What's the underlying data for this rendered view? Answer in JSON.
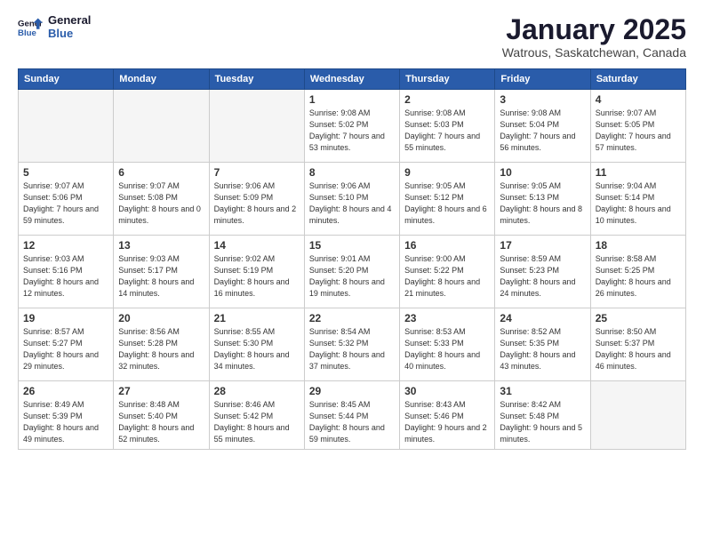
{
  "header": {
    "logo_line1": "General",
    "logo_line2": "Blue",
    "month": "January 2025",
    "location": "Watrous, Saskatchewan, Canada"
  },
  "weekdays": [
    "Sunday",
    "Monday",
    "Tuesday",
    "Wednesday",
    "Thursday",
    "Friday",
    "Saturday"
  ],
  "weeks": [
    [
      {
        "day": "",
        "text": ""
      },
      {
        "day": "",
        "text": ""
      },
      {
        "day": "",
        "text": ""
      },
      {
        "day": "1",
        "text": "Sunrise: 9:08 AM\nSunset: 5:02 PM\nDaylight: 7 hours and 53 minutes."
      },
      {
        "day": "2",
        "text": "Sunrise: 9:08 AM\nSunset: 5:03 PM\nDaylight: 7 hours and 55 minutes."
      },
      {
        "day": "3",
        "text": "Sunrise: 9:08 AM\nSunset: 5:04 PM\nDaylight: 7 hours and 56 minutes."
      },
      {
        "day": "4",
        "text": "Sunrise: 9:07 AM\nSunset: 5:05 PM\nDaylight: 7 hours and 57 minutes."
      }
    ],
    [
      {
        "day": "5",
        "text": "Sunrise: 9:07 AM\nSunset: 5:06 PM\nDaylight: 7 hours and 59 minutes."
      },
      {
        "day": "6",
        "text": "Sunrise: 9:07 AM\nSunset: 5:08 PM\nDaylight: 8 hours and 0 minutes."
      },
      {
        "day": "7",
        "text": "Sunrise: 9:06 AM\nSunset: 5:09 PM\nDaylight: 8 hours and 2 minutes."
      },
      {
        "day": "8",
        "text": "Sunrise: 9:06 AM\nSunset: 5:10 PM\nDaylight: 8 hours and 4 minutes."
      },
      {
        "day": "9",
        "text": "Sunrise: 9:05 AM\nSunset: 5:12 PM\nDaylight: 8 hours and 6 minutes."
      },
      {
        "day": "10",
        "text": "Sunrise: 9:05 AM\nSunset: 5:13 PM\nDaylight: 8 hours and 8 minutes."
      },
      {
        "day": "11",
        "text": "Sunrise: 9:04 AM\nSunset: 5:14 PM\nDaylight: 8 hours and 10 minutes."
      }
    ],
    [
      {
        "day": "12",
        "text": "Sunrise: 9:03 AM\nSunset: 5:16 PM\nDaylight: 8 hours and 12 minutes."
      },
      {
        "day": "13",
        "text": "Sunrise: 9:03 AM\nSunset: 5:17 PM\nDaylight: 8 hours and 14 minutes."
      },
      {
        "day": "14",
        "text": "Sunrise: 9:02 AM\nSunset: 5:19 PM\nDaylight: 8 hours and 16 minutes."
      },
      {
        "day": "15",
        "text": "Sunrise: 9:01 AM\nSunset: 5:20 PM\nDaylight: 8 hours and 19 minutes."
      },
      {
        "day": "16",
        "text": "Sunrise: 9:00 AM\nSunset: 5:22 PM\nDaylight: 8 hours and 21 minutes."
      },
      {
        "day": "17",
        "text": "Sunrise: 8:59 AM\nSunset: 5:23 PM\nDaylight: 8 hours and 24 minutes."
      },
      {
        "day": "18",
        "text": "Sunrise: 8:58 AM\nSunset: 5:25 PM\nDaylight: 8 hours and 26 minutes."
      }
    ],
    [
      {
        "day": "19",
        "text": "Sunrise: 8:57 AM\nSunset: 5:27 PM\nDaylight: 8 hours and 29 minutes."
      },
      {
        "day": "20",
        "text": "Sunrise: 8:56 AM\nSunset: 5:28 PM\nDaylight: 8 hours and 32 minutes."
      },
      {
        "day": "21",
        "text": "Sunrise: 8:55 AM\nSunset: 5:30 PM\nDaylight: 8 hours and 34 minutes."
      },
      {
        "day": "22",
        "text": "Sunrise: 8:54 AM\nSunset: 5:32 PM\nDaylight: 8 hours and 37 minutes."
      },
      {
        "day": "23",
        "text": "Sunrise: 8:53 AM\nSunset: 5:33 PM\nDaylight: 8 hours and 40 minutes."
      },
      {
        "day": "24",
        "text": "Sunrise: 8:52 AM\nSunset: 5:35 PM\nDaylight: 8 hours and 43 minutes."
      },
      {
        "day": "25",
        "text": "Sunrise: 8:50 AM\nSunset: 5:37 PM\nDaylight: 8 hours and 46 minutes."
      }
    ],
    [
      {
        "day": "26",
        "text": "Sunrise: 8:49 AM\nSunset: 5:39 PM\nDaylight: 8 hours and 49 minutes."
      },
      {
        "day": "27",
        "text": "Sunrise: 8:48 AM\nSunset: 5:40 PM\nDaylight: 8 hours and 52 minutes."
      },
      {
        "day": "28",
        "text": "Sunrise: 8:46 AM\nSunset: 5:42 PM\nDaylight: 8 hours and 55 minutes."
      },
      {
        "day": "29",
        "text": "Sunrise: 8:45 AM\nSunset: 5:44 PM\nDaylight: 8 hours and 59 minutes."
      },
      {
        "day": "30",
        "text": "Sunrise: 8:43 AM\nSunset: 5:46 PM\nDaylight: 9 hours and 2 minutes."
      },
      {
        "day": "31",
        "text": "Sunrise: 8:42 AM\nSunset: 5:48 PM\nDaylight: 9 hours and 5 minutes."
      },
      {
        "day": "",
        "text": ""
      }
    ]
  ]
}
